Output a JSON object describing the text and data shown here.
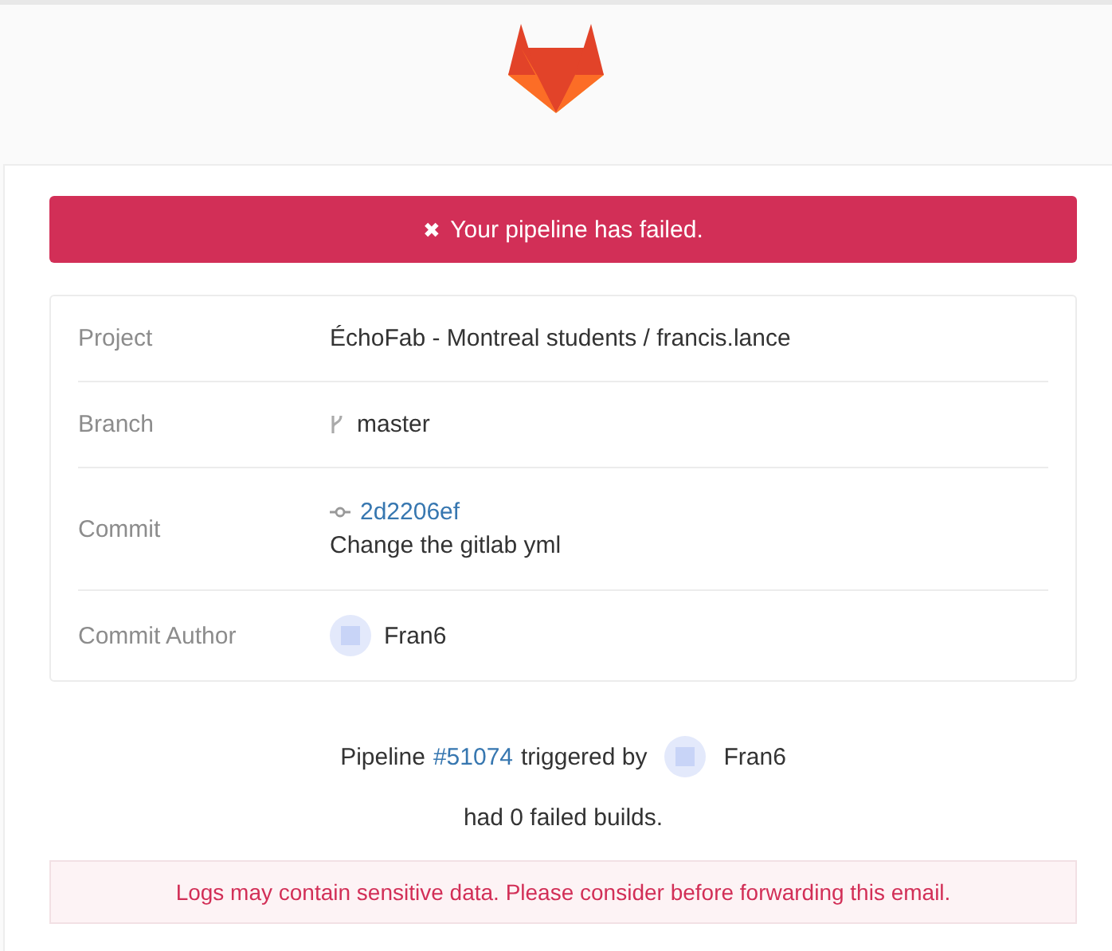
{
  "banner": {
    "icon": "✖",
    "text": "Your pipeline has failed."
  },
  "details": [
    {
      "kind": "text",
      "label": "Project",
      "value": "ÉchoFab - Montreal students / francis.lance"
    },
    {
      "kind": "branch",
      "label": "Branch",
      "value": "master"
    },
    {
      "kind": "commit",
      "label": "Commit",
      "sha": "2d2206ef",
      "message": "Change the gitlab yml"
    },
    {
      "kind": "author",
      "label": "Commit Author",
      "value": "Fran6"
    }
  ],
  "pipeline": {
    "prefix": "Pipeline",
    "id": "#51074",
    "middle": "triggered by",
    "user": "Fran6",
    "summary": "had 0 failed builds."
  },
  "warning": "Logs may contain sensitive data. Please consider before forwarding this email."
}
